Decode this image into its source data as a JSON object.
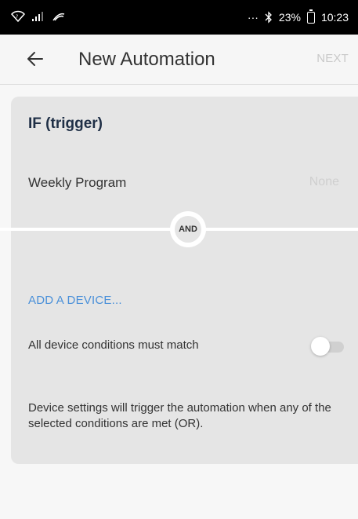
{
  "status_bar": {
    "left_icons": [
      "wifi-icon",
      "signal-icon",
      "cast-icon"
    ],
    "dots": "···",
    "bluetooth_icon": "bluetooth-icon",
    "battery": "23%",
    "time": "10:23"
  },
  "app_bar": {
    "back_icon": "arrow-left-icon",
    "title": "New Automation",
    "next_label": "NEXT"
  },
  "trigger_card": {
    "heading": "IF (trigger)",
    "weekly_program": {
      "label": "Weekly Program",
      "value": "None"
    },
    "and_label": "AND",
    "add_device_label": "ADD A DEVICE...",
    "all_conditions": {
      "label": "All device conditions must match",
      "enabled": false
    },
    "help_text": "Device settings will trigger the automation when any of the selected conditions are met (OR)."
  },
  "colors": {
    "accent_link": "#4a90d9",
    "heading": "#1f2f46",
    "card_bg": "#e5e5e5",
    "disabled_text": "#c9c9c9"
  }
}
